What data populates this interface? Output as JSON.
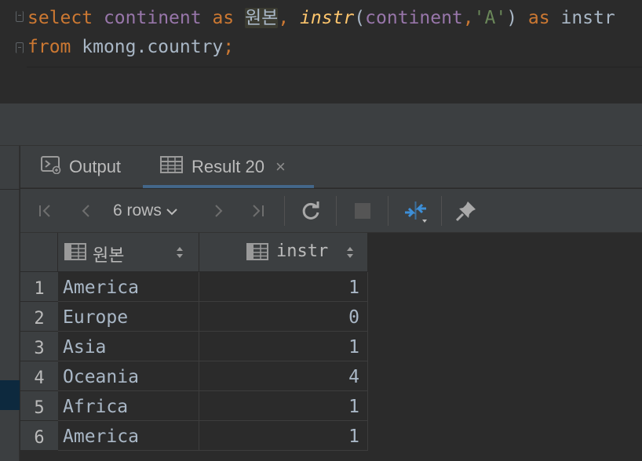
{
  "editor": {
    "line1": {
      "kw_select": "select",
      "col_continent": "continent",
      "kw_as1": "as",
      "alias_korean": "원본",
      "comma": ",",
      "fn_instr": "instr",
      "paren_open": "(",
      "arg_continent": "continent",
      "arg_comma": ",",
      "arg_string": "'A'",
      "paren_close": ")",
      "kw_as2": "as",
      "alias_instr": "instr"
    },
    "line2": {
      "kw_from": "from",
      "table": "kmong.country",
      "semicolon": ";"
    }
  },
  "tabs": {
    "output_label": "Output",
    "result_label": "Result 20",
    "close_icon": "×"
  },
  "toolbar": {
    "rows_label": "6 rows",
    "icons": [
      "first-page-icon",
      "prev-page-icon",
      "rows-dropdown-icon",
      "next-page-icon",
      "last-page-icon",
      "refresh-icon",
      "stop-icon",
      "compare-icon",
      "pin-icon"
    ]
  },
  "grid": {
    "columns": [
      "원본",
      "instr"
    ],
    "rows": [
      {
        "num": "1",
        "col1": "America",
        "col2": "1"
      },
      {
        "num": "2",
        "col1": "Europe",
        "col2": "0"
      },
      {
        "num": "3",
        "col1": "Asia",
        "col2": "1"
      },
      {
        "num": "4",
        "col1": "Oceania",
        "col2": "4"
      },
      {
        "num": "5",
        "col1": "Africa",
        "col2": "1"
      },
      {
        "num": "6",
        "col1": "America",
        "col2": "1"
      }
    ]
  },
  "colors": {
    "keyword": "#cc7832",
    "column": "#9876aa",
    "function": "#ffc66d",
    "string": "#6a8759",
    "text": "#a9b7c6",
    "accent": "#4a88c7",
    "panel": "#3c3f41",
    "background": "#2b2b2b"
  }
}
